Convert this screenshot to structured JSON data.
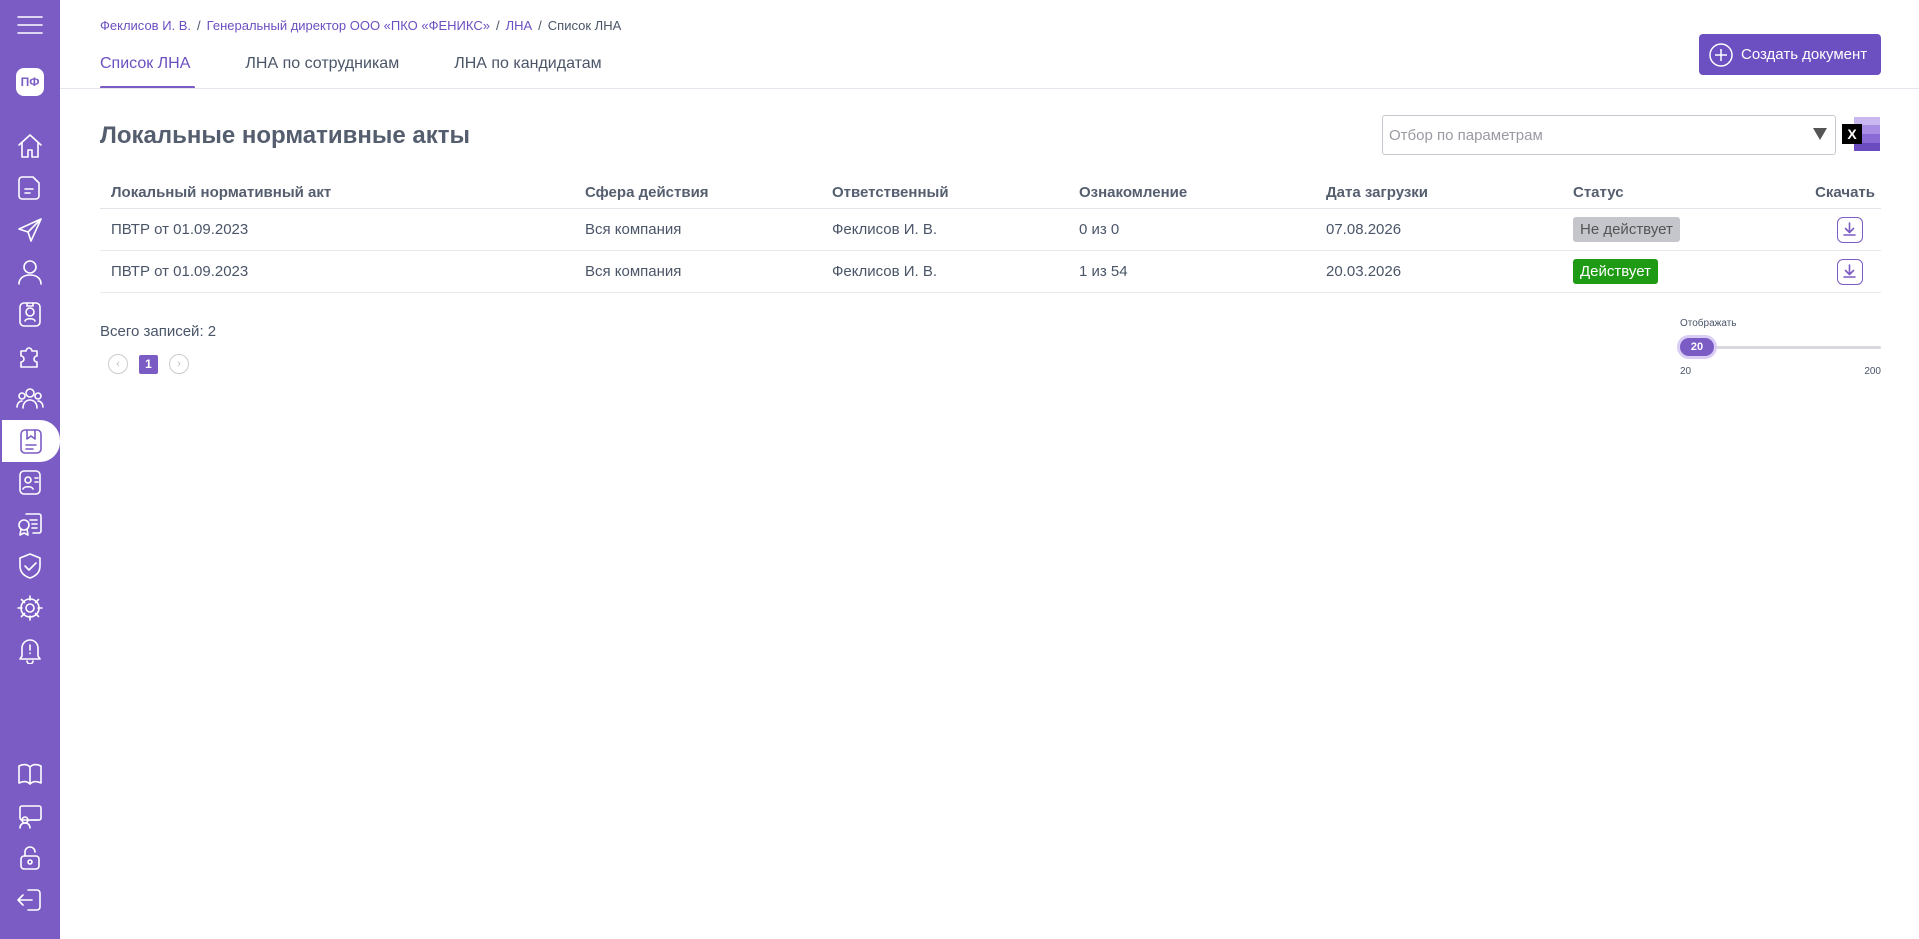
{
  "sidebar": {
    "avatar_initials": "ПФ",
    "icons": [
      "menu-icon",
      "home-icon",
      "document-icon",
      "send-icon",
      "user-icon",
      "badge-icon",
      "puzzle-icon",
      "team-icon",
      "regulation-icon",
      "contact-icon",
      "certificate-icon",
      "shield-icon",
      "gear-icon",
      "bell-icon",
      "book-icon",
      "training-icon",
      "lock-icon",
      "logout-icon"
    ]
  },
  "breadcrumb": {
    "items": [
      "Феклисов И. В.",
      "Генеральный директор ООО «ПКО «ФЕНИКС»",
      "ЛНА"
    ],
    "current": "Список ЛНА"
  },
  "tabs": [
    {
      "label": "Список ЛНА",
      "active": true
    },
    {
      "label": "ЛНА по сотрудникам",
      "active": false
    },
    {
      "label": "ЛНА по кандидатам",
      "active": false
    }
  ],
  "create_button": {
    "label": "Создать документ"
  },
  "page_title": "Локальные нормативные акты",
  "filter": {
    "placeholder": "Отбор по параметрам"
  },
  "excel_label": "X",
  "table": {
    "headers": [
      "Локальный нормативный акт",
      "Сфера действия",
      "Ответственный",
      "Ознакомление",
      "Дата загрузки",
      "Статус",
      "Скачать"
    ],
    "rows": [
      {
        "name": "ПВТР от 01.09.2023",
        "scope": "Вся компания",
        "responsible": "Феклисов И. В.",
        "acquaint": "0 из 0",
        "date": "07.08.2026",
        "status": "Не действует",
        "status_type": "inactive"
      },
      {
        "name": "ПВТР от 01.09.2023",
        "scope": "Вся компания",
        "responsible": "Феклисов И. В.",
        "acquaint": "1 из 54",
        "date": "20.03.2026",
        "status": "Действует",
        "status_type": "active"
      }
    ]
  },
  "total_label": "Всего записей: 2",
  "pagination": {
    "current": "1"
  },
  "page_size": {
    "label": "Отображать",
    "value": "20",
    "min": "20",
    "max": "200"
  },
  "colors": {
    "accent": "#7b5cc4",
    "active_status": "#1f9a14",
    "inactive_status": "#c4c6cc"
  }
}
